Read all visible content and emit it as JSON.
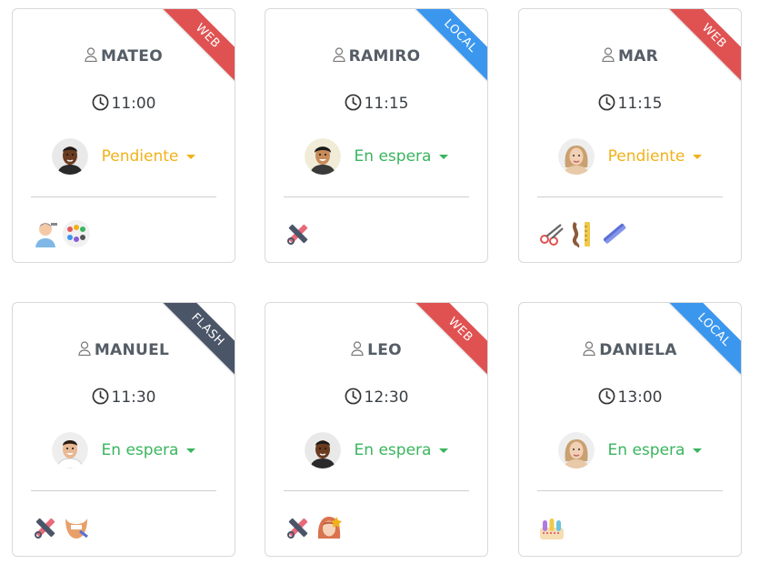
{
  "colors": {
    "ribbon_web": "#e05252",
    "ribbon_local": "#3b97ee",
    "ribbon_flash": "#4a5568",
    "status_pendiente": "#f0b21a",
    "status_espera": "#3ab55e"
  },
  "cards": [
    {
      "name": "MATEO",
      "time": "11:00",
      "ribbon": "WEB",
      "ribbon_type": "web",
      "status": "Pendiente",
      "status_type": "pendiente",
      "avatar": "man-dark-avatar",
      "services": [
        "barber-cut-icon",
        "color-palette-icon"
      ]
    },
    {
      "name": "RAMIRO",
      "time": "11:15",
      "ribbon": "LOCAL",
      "ribbon_type": "local",
      "status": "En espera",
      "status_type": "espera",
      "avatar": "man-smiling-avatar",
      "services": [
        "scissors-comb-icon"
      ]
    },
    {
      "name": "MAR",
      "time": "11:15",
      "ribbon": "WEB",
      "ribbon_type": "web",
      "status": "Pendiente",
      "status_type": "pendiente",
      "avatar": "woman-blonde-avatar",
      "services": [
        "scissors-cut-icon",
        "hair-length-icon",
        "straightener-icon"
      ]
    },
    {
      "name": "MANUEL",
      "time": "11:30",
      "ribbon": "FLASH",
      "ribbon_type": "flash",
      "status": "En espera",
      "status_type": "espera",
      "avatar": "man-light-avatar",
      "services": [
        "scissors-comb-icon",
        "beard-icon"
      ]
    },
    {
      "name": "LEO",
      "time": "12:30",
      "ribbon": "WEB",
      "ribbon_type": "web",
      "status": "En espera",
      "status_type": "espera",
      "avatar": "man-dark-avatar",
      "services": [
        "scissors-comb-icon",
        "woman-hair-icon"
      ]
    },
    {
      "name": "DANIELA",
      "time": "13:00",
      "ribbon": "LOCAL",
      "ribbon_type": "local",
      "status": "En espera",
      "status_type": "espera",
      "avatar": "woman-blonde-avatar",
      "services": [
        "nail-polish-icon"
      ]
    }
  ]
}
